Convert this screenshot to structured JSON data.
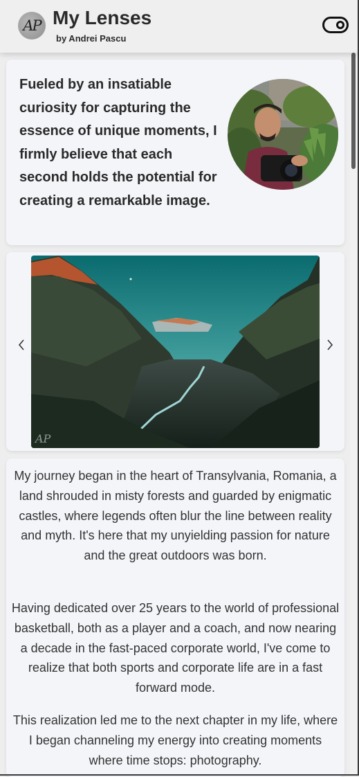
{
  "header": {
    "logo_text": "AP",
    "title": "My Lenses",
    "byline": "by Andrei Pascu",
    "toggle_icon": "toggle-on-icon"
  },
  "intro": {
    "text": "Fueled by an insatiable curiosity for capturing the essence of unique moments, I firmly believe that each second holds the potential for creating a remarkable image."
  },
  "carousel": {
    "prev_icon": "chevron-left-icon",
    "next_icon": "chevron-right-icon",
    "watermark": "AP"
  },
  "story": {
    "paragraphs": [
      "My journey began in the heart of Transylvania, Romania, a land shrouded in misty forests and guarded by enigmatic castles, where legends often blur the line between reality and myth. It's here that my unyielding passion for nature and the great outdoors was born.",
      "Having dedicated over 25 years to the world of professional basketball, both as a player and a coach, and now nearing a decade in the fast-paced corporate world, I've come to realize that both sports and corporate life are in a fast forward mode.",
      "This realization led me to the next chapter in my life, where I began channeling my energy into creating moments where time stops: photography."
    ]
  },
  "colors": {
    "page_background": "#eeeeef",
    "card_background": "#f4f5f9",
    "text": "#2b2b2b"
  }
}
